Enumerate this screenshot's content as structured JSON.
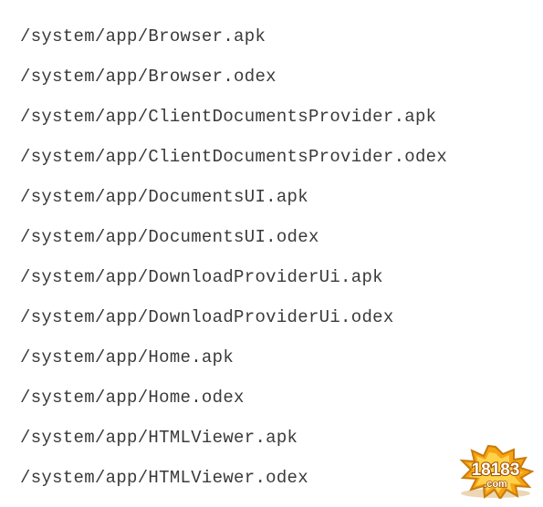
{
  "files": [
    "/system/app/Browser.apk",
    "/system/app/Browser.odex",
    "/system/app/ClientDocumentsProvider.apk",
    "/system/app/ClientDocumentsProvider.odex",
    "/system/app/DocumentsUI.apk",
    "/system/app/DocumentsUI.odex",
    "/system/app/DownloadProviderUi.apk",
    "/system/app/DownloadProviderUi.odex",
    "/system/app/Home.apk",
    "/system/app/Home.odex",
    "/system/app/HTMLViewer.apk",
    "/system/app/HTMLViewer.odex"
  ],
  "watermark": {
    "text_top": "18183",
    "text_bottom": ".com"
  }
}
